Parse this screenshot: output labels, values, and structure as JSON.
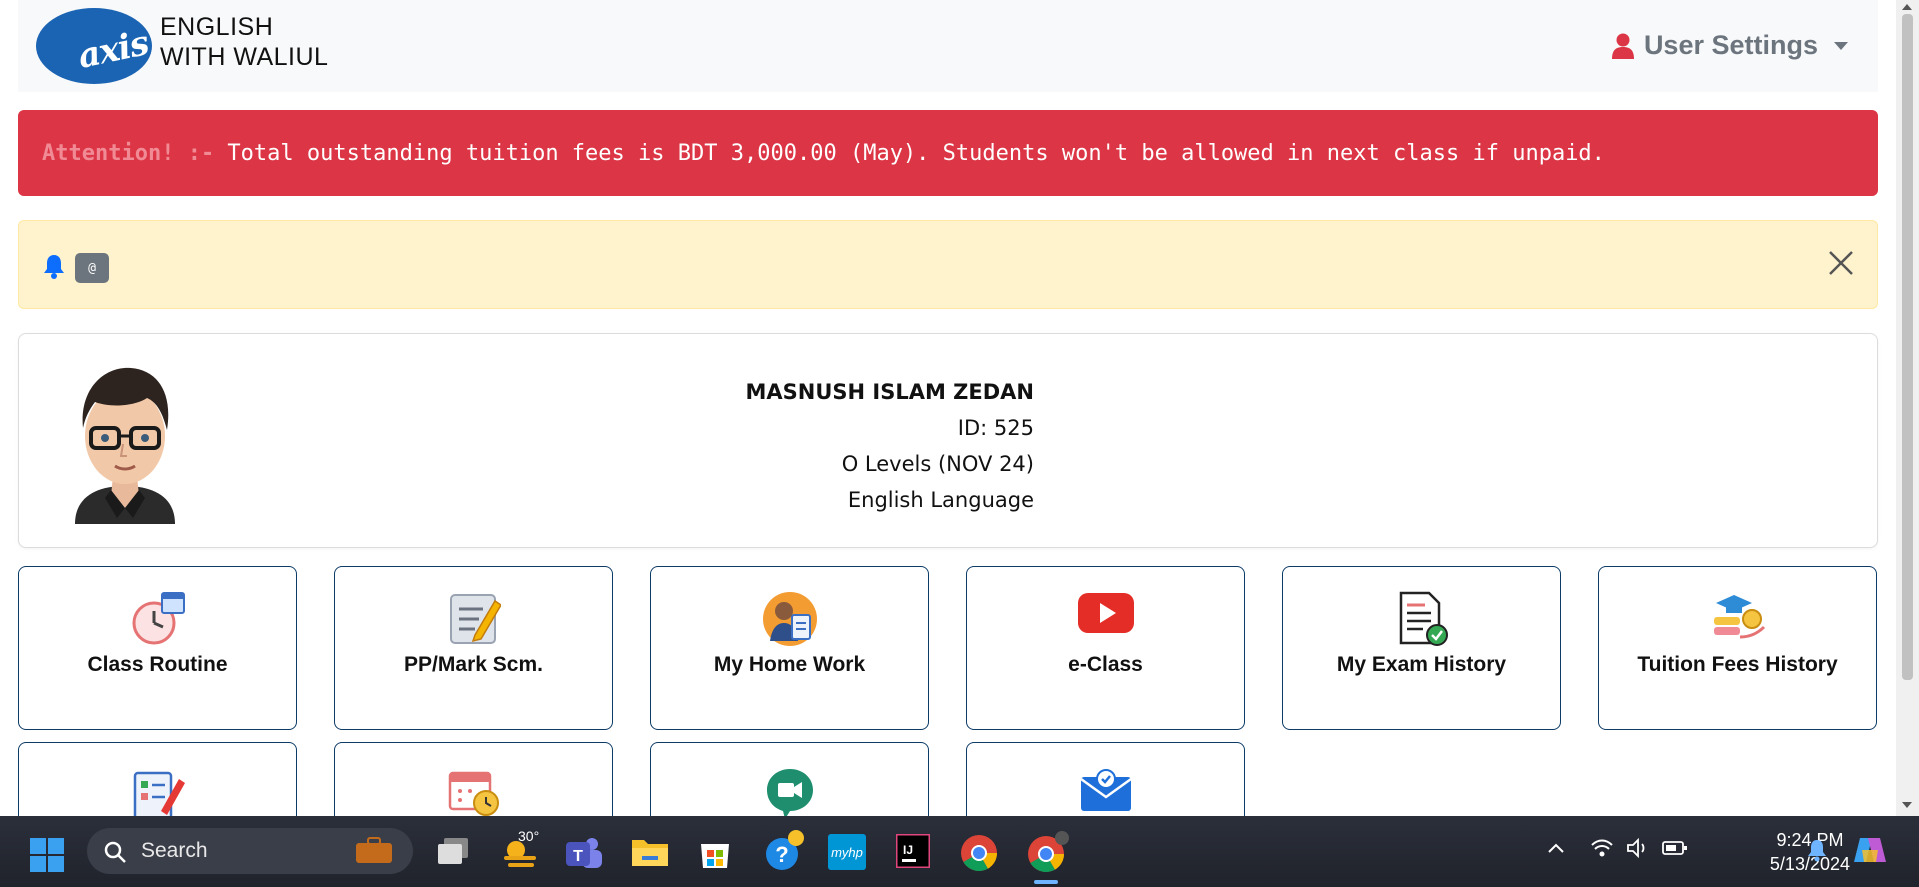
{
  "brand": {
    "logo_text": "axis",
    "line1": "ENGLISH",
    "line2": "WITH WALIUL"
  },
  "user_menu": {
    "label": "User Settings"
  },
  "alert": {
    "prefix": "Attention! :-",
    "message": " Total outstanding tuition fees is BDT 3,000.00 (May). Students won't be allowed in next class if unpaid."
  },
  "notice": {
    "badge": "@"
  },
  "profile": {
    "name": "MASNUSH ISLAM ZEDAN",
    "id": "ID: 525",
    "level": "O Levels (NOV 24)",
    "subject": "English Language"
  },
  "tiles": [
    {
      "label": "Class Routine",
      "icon": "clock-calendar-icon"
    },
    {
      "label": "PP/Mark Scm.",
      "icon": "notepad-pencil-icon"
    },
    {
      "label": "My Home Work",
      "icon": "student-document-icon"
    },
    {
      "label": "e-Class",
      "icon": "youtube-play-icon"
    },
    {
      "label": "My Exam History",
      "icon": "exam-document-icon"
    },
    {
      "label": "Tuition Fees History",
      "icon": "graduation-money-icon"
    },
    {
      "label": "",
      "icon": "checklist-pencil-icon"
    },
    {
      "label": "",
      "icon": "calendar-clock-icon"
    },
    {
      "label": "",
      "icon": "google-meet-icon"
    },
    {
      "label": "",
      "icon": "envelope-check-icon"
    }
  ],
  "taskbar": {
    "search_placeholder": "Search",
    "weather_temp": "30°",
    "time": "9:24 PM",
    "date": "5/13/2024"
  },
  "colors": {
    "danger": "#dc3545",
    "warning_bg": "#fff3cd",
    "tile_border": "#0d3b66",
    "user_icon": "#dc3545"
  }
}
